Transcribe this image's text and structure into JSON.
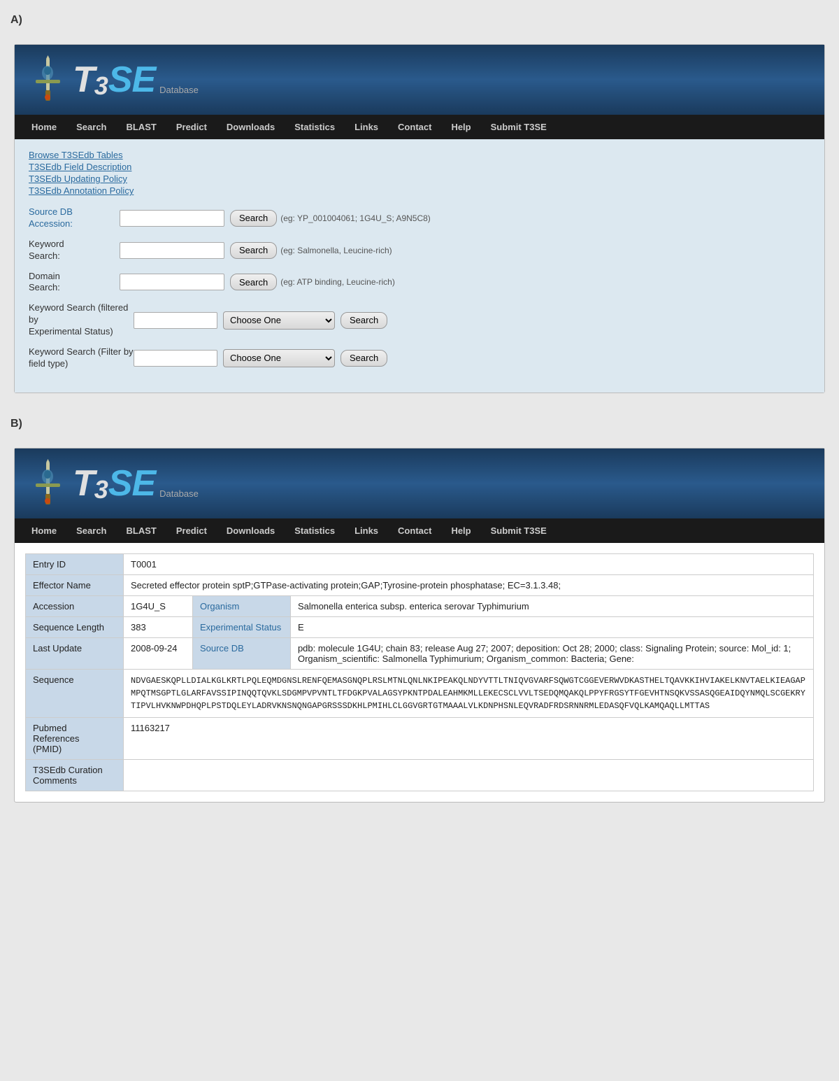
{
  "sectionA": {
    "label": "A)",
    "logo": {
      "t3": "T",
      "sub3": "3",
      "se": "SE",
      "database": "Database"
    },
    "nav": {
      "items": [
        "Home",
        "Search",
        "BLAST",
        "Predict",
        "Downloads",
        "Statistics",
        "Links",
        "Contact",
        "Help",
        "Submit T3SE"
      ]
    },
    "links": [
      "Browse T3SEdb Tables",
      "T3SEdb Field Description",
      "T3SEdb Updating Policy",
      "T3SEdb Annotation Policy"
    ],
    "form": {
      "sourceDB": {
        "label": "Source DB\nAccession:",
        "placeholder": "",
        "searchBtn": "Search",
        "hint": "(eg: YP_001004061; 1G4U_S; A9N5C8)"
      },
      "keyword": {
        "label": "Keyword\nSearch:",
        "placeholder": "",
        "searchBtn": "Search",
        "hint": "(eg: Salmonella, Leucine-rich)"
      },
      "domain": {
        "label": "Domain\nSearch:",
        "placeholder": "",
        "searchBtn": "Search",
        "hint": "(eg: ATP binding, Leucine-rich)"
      },
      "keywordFiltered": {
        "label": "Keyword Search (filtered by\nExperimental Status)",
        "placeholder": "",
        "chooseOne": "Choose One",
        "searchBtn": "Search"
      },
      "keywordField": {
        "label": "Keyword Search (Filter by\nfield type)",
        "placeholder": "",
        "chooseOne": "Choose One",
        "searchBtn": "Search"
      }
    }
  },
  "sectionB": {
    "label": "B)",
    "logo": {
      "t3": "T",
      "sub3": "3",
      "se": "SE",
      "database": "Database"
    },
    "nav": {
      "items": [
        "Home",
        "Search",
        "BLAST",
        "Predict",
        "Downloads",
        "Statistics",
        "Links",
        "Contact",
        "Help",
        "Submit T3SE"
      ]
    },
    "table": {
      "rows": [
        {
          "label": "Entry ID",
          "value": "T0001",
          "span": 3
        },
        {
          "label": "Effector Name",
          "value": "Secreted effector protein sptP;GTPase-activating protein;GAP;Tyrosine-protein phosphatase; EC=3.1.3.48;",
          "span": 3
        },
        {
          "label": "Accession",
          "value": "1G4U_S",
          "midLabel": "Organism",
          "midValue": "Salmonella enterica subsp. enterica serovar Typhimurium"
        },
        {
          "label": "Sequence Length",
          "value": "383",
          "midLabel": "Experimental Status",
          "midValue": "E"
        },
        {
          "label": "Last Update",
          "value": "2008-09-24",
          "midLabel": "Source DB",
          "midValue": "pdb: molecule 1G4U; chain 83; release Aug 27; 2007; deposition: Oct 28; 2000; class: Signaling Protein; source: Mol_id: 1; Organism_scientific: Salmonella Typhimurium; Organism_common: Bacteria; Gene:"
        },
        {
          "label": "Sequence",
          "value": "NDVGAESKQPLLDIALKGLKRTLPQLEQMDGNSLRENFQEMASGNQPLRSLMTNLQNLNKIPEAKQLNDYVTTLTNIQVGVARFSQWGTCGGEVERWVDKASTHELTQAVKKIHVIAKELKNVTAELKIEAGAPMPQTMSGPTLGLARFAVSSIPINQQTQVKLSDGMPVPVNTLTFDGKPVALAGSYPKNTPDALEAHMKMLLEKECSCLVVLTSEDQMQAKQLPPYFRGSYTFGEVHTNSQKVSSASQGEAIDQYNMQLSCGEKRYTIPVLHVKNWPDHQPLPSTDQLEYLADRVKNSNQNGAPGRSSSDKHLPMIHLCLGGVGRTGTMAAALVLKDNPHSNLEQVRADFRDSRNNRMLEDASQFVQLKAMQAQLLMTTAS",
          "span": 3,
          "isSequence": true
        },
        {
          "label": "Pubmed\nReferences\n(PMID)",
          "value": "11163217",
          "span": 3
        },
        {
          "label": "T3SEdb Curation\nComments",
          "value": "",
          "span": 3
        }
      ]
    }
  }
}
